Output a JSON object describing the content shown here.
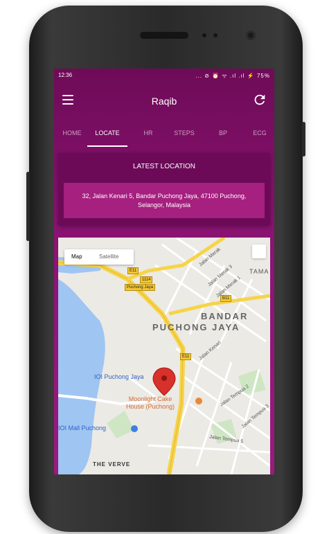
{
  "status_bar": {
    "time": "12:36",
    "indicators": "... ⊘ ⏰ ᯤ .ıl .ıl ⚡ 75%"
  },
  "app_bar": {
    "title": "Raqib"
  },
  "tabs": [
    {
      "label": "HOME"
    },
    {
      "label": "LOCATE"
    },
    {
      "label": "HR"
    },
    {
      "label": "STEPS"
    },
    {
      "label": "BP"
    },
    {
      "label": "ECG"
    }
  ],
  "active_tab": "LOCATE",
  "location_card": {
    "title": "LATEST LOCATION",
    "address": "32, Jalan Kenari 5, Bandar Puchong Jaya, 47100 Puchong, Selangor, Malaysia"
  },
  "map": {
    "type_options": {
      "map": "Map",
      "satellite": "Satellite"
    },
    "selected_type": "Map",
    "labels": {
      "area": "BANDAR",
      "area2": "PUCHONG JAYA",
      "tam": "TAMA",
      "poi1": "IOI Puchong Jaya",
      "poi2_line1": "Moonlight Cake",
      "poi2_line2": "House (Puchong)",
      "poi3": "IOI Mall Puchong",
      "verve": "THE VERVE",
      "e11a": "E11",
      "e11b": "E11",
      "r1114": "1114",
      "puchong_jaya_shield": "Puchong Jaya",
      "b11": "B11",
      "jalan_merak": "Jalan Merak",
      "jalan_merak3": "Jalan Merak 3",
      "jalan_merak1": "Jalan Merak 1",
      "jalan_kenari": "Jalan Kenari",
      "jalan_tempua2": "Jalan Tempua 2",
      "jalan_tempua5": "Jalan Tempua 5",
      "jalan_tempua3": "Jalan Tempua 3"
    }
  },
  "colors": {
    "primary": "#7a0f63",
    "card": "#6c0a58",
    "address_box": "#a5207f",
    "road_major": "#f6d44a",
    "water": "#9fc5f2",
    "marker": "#d8302a"
  }
}
